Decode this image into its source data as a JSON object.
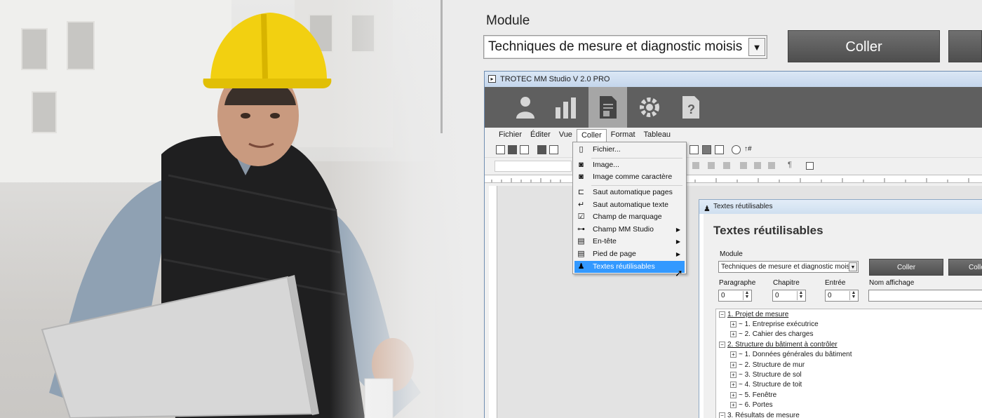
{
  "background_ui": {
    "module_label": "Module",
    "module_value": "Techniques de mesure et diagnostic moisis",
    "paste_button": "Coller"
  },
  "app": {
    "title": "TROTEC MM Studio V 2.0 PRO",
    "ribbon_icons": [
      "user-icon",
      "chart-icon",
      "document-icon",
      "gear-icon",
      "help-document-icon"
    ],
    "menu": [
      "Fichier",
      "Éditer",
      "Vue",
      "Coller",
      "Format",
      "Tableau"
    ],
    "open_menu": "Coller"
  },
  "dropdown": {
    "items": [
      {
        "label": "Fichier...",
        "icon": "file-insert-icon"
      },
      {
        "label": "Image...",
        "icon": "camera-icon"
      },
      {
        "label": "Image comme caractère",
        "icon": "camera-char-icon"
      },
      {
        "label": "Saut automatique pages",
        "icon": "page-break-icon"
      },
      {
        "label": "Saut automatique texte",
        "icon": "text-break-icon"
      },
      {
        "label": "Champ de marquage",
        "icon": "checkbox-icon"
      },
      {
        "label": "Champ MM Studio",
        "icon": "key-icon",
        "submenu": true
      },
      {
        "label": "En-tête",
        "icon": "header-icon",
        "submenu": true
      },
      {
        "label": "Pied de page",
        "icon": "footer-icon",
        "submenu": true
      },
      {
        "label": "Textes réutilisables",
        "icon": "person-icon",
        "selected": true
      }
    ]
  },
  "dialog": {
    "window_title": "Textes réutilisables",
    "heading": "Textes réutilisables",
    "module_label": "Module",
    "module_value": "Techniques de mesure et diagnostic moisis",
    "paste_button": "Coller",
    "paste_button_2": "Colle",
    "paragraph_label": "Paragraphe",
    "chapter_label": "Chapitre",
    "entry_label": "Entrée",
    "display_name_label": "Nom affichage",
    "paragraph_value": "0",
    "chapter_value": "0",
    "entry_value": "0",
    "tree": [
      {
        "text": "1. Projet de mesure",
        "level": 0,
        "expand": "−"
      },
      {
        "text": "~ 1. Entreprise exécutrice",
        "level": 1,
        "expand": "+"
      },
      {
        "text": "~ 2. Cahier des charges",
        "level": 1,
        "expand": "+"
      },
      {
        "text": "2. Structure du bâtiment à contrôler",
        "level": 0,
        "expand": "−"
      },
      {
        "text": "~ 1. Données générales du bâtiment",
        "level": 1,
        "expand": "+"
      },
      {
        "text": "~ 2. Structure de mur",
        "level": 1,
        "expand": "+"
      },
      {
        "text": "~ 3. Structure de sol",
        "level": 1,
        "expand": "+"
      },
      {
        "text": "~ 4. Structure de toit",
        "level": 1,
        "expand": "+"
      },
      {
        "text": "~ 5. Fenêtre",
        "level": 1,
        "expand": "+"
      },
      {
        "text": "~ 6. Portes",
        "level": 1,
        "expand": "+"
      },
      {
        "text": "3. Résultats de mesure",
        "level": 0,
        "expand": "−"
      }
    ]
  }
}
